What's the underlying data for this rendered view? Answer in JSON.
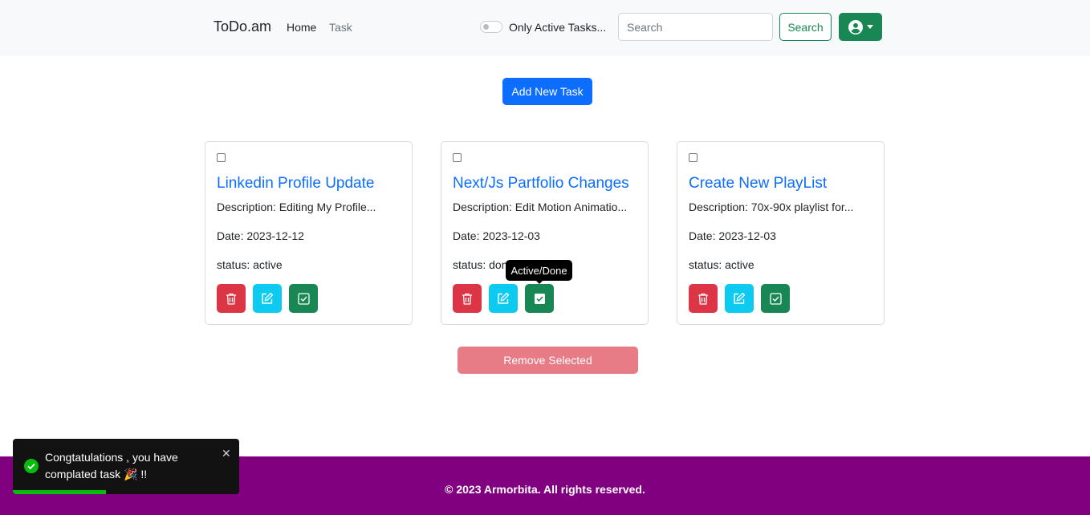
{
  "navbar": {
    "brand": "ToDo.am",
    "links": [
      {
        "label": "Home"
      },
      {
        "label": "Task"
      }
    ],
    "toggle_label": "Only Active Tasks...",
    "toggle_on": false,
    "search": {
      "placeholder": "Search",
      "value": "",
      "button_label": "Search"
    },
    "user_icon": "user-circle-icon"
  },
  "main": {
    "add_button_label": "Add New Task",
    "tasks": [
      {
        "title": "Linkedin Profile Update",
        "description": "Description: Editing My Profile...",
        "date": "Date: 2023-12-12",
        "status": "status: active",
        "checked": false
      },
      {
        "title": "Next/Js Partfolio Changes",
        "description": "Description: Edit Motion Animatio...",
        "date": "Date: 2023-12-03",
        "status": "status: done",
        "checked": false
      },
      {
        "title": "Create New PlayList",
        "description": "Description: 70x-90x playlist for...",
        "date": "Date: 2023-12-03",
        "status": "status: active",
        "checked": false
      }
    ],
    "action_icons": {
      "delete": "trash-icon",
      "edit": "edit-icon",
      "toggle": "check-square-icon"
    },
    "tooltip": "Active/Done",
    "remove_button_label": "Remove Selected"
  },
  "footer": {
    "text": "© 2023 Armorbita. All rights reserved."
  },
  "toast": {
    "message": "Congtatulations , you have complated task 🎉 !!",
    "progress": 0.41,
    "icon": "success-check-icon"
  },
  "colors": {
    "primary": "#0d6efd",
    "success": "#198754",
    "danger": "#dc3545",
    "info": "#0dcaf0",
    "footer": "#800080",
    "toast_progress": "#07bc0c"
  }
}
